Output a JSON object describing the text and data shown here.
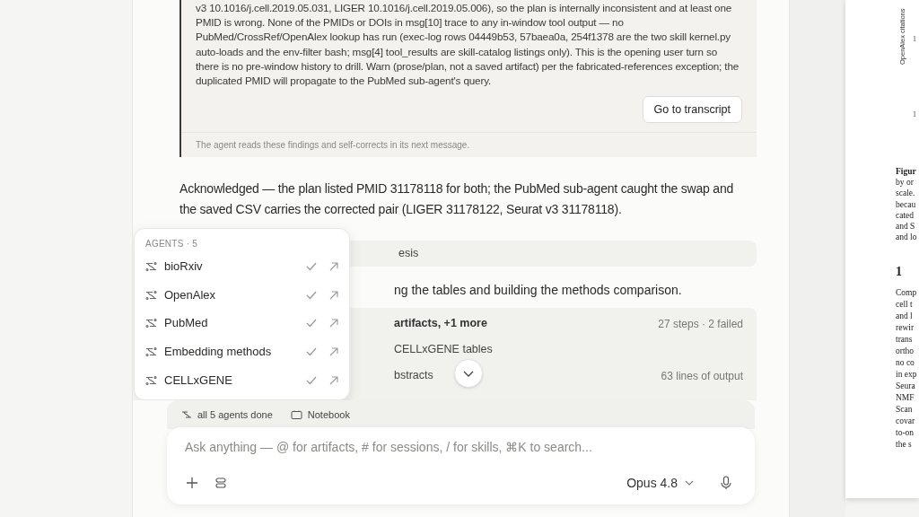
{
  "warning_card": {
    "body": "v3 10.1016/j.cell.2019.05.031, LIGER 10.1016/j.cell.2019.05.006), so the plan is internally inconsistent and at least one PMID is wrong. None of the PMIDs or DOIs in msg[10] trace to any in-window tool output — no PubMed/CrossRef/OpenAlex lookup has run (exec-log rows 04449b53, 57baea0a, 254f1378 are the two skill kernel.py auto-loads and the env-filter bash; msg[4] tool_results are skill-catalog listings only). This is the opening user turn so there is no pre-window history to drill. Warn (prose/plan, not a saved artifact) per the fabricated-references exception; the duplicated PMID will propagate to the PubMed sub-agent's query.",
    "button": "Go to transcript",
    "footer": "The agent reads these findings and self-corrects in its next message."
  },
  "message": "Acknowledged — the plan listed PMID 31178118 for both; the PubMed sub-agent caught the swap and the saved CSV carries the corrected pair (LIGER 31178122, Seurat v3 31178118).",
  "thinking_bar": "esis",
  "status_line": "ng the tables and building the methods comparison.",
  "activity_rows": [
    {
      "kind": "summary",
      "label": "artifacts, +1 more",
      "meta": "27 steps · 2 failed"
    },
    {
      "kind": "step",
      "label": "CELLxGENE tables"
    },
    {
      "kind": "step",
      "label": "bstracts",
      "meta": "63 lines of output"
    }
  ],
  "agents_popup": {
    "header": "AGENTS · 5",
    "items": [
      {
        "label": "bioRxiv",
        "done": true
      },
      {
        "label": "OpenAlex",
        "done": true
      },
      {
        "label": "PubMed",
        "done": true
      },
      {
        "label": "Embedding methods",
        "done": true
      },
      {
        "label": "CELLxGENE",
        "done": true
      }
    ]
  },
  "status_bar": {
    "agents": "all 5 agents done",
    "notebook": "Notebook"
  },
  "composer": {
    "placeholder": "Ask anything — @ for artifacts, # for sessions, / for skills, ⌘K to search...",
    "model": "Opus 4.8"
  },
  "document": {
    "axis_label": "OpenAlex citations",
    "ticks": [
      "1",
      "1"
    ],
    "caption_lines": [
      "Figur",
      "by or",
      "scale.",
      "becau",
      "cated",
      "and S",
      "and lo"
    ],
    "section": "1",
    "body_lines": [
      "Comp",
      "cell t",
      "and l",
      "rewir",
      "trans",
      "ortho",
      "no co",
      "in exp",
      "Seura",
      "NMF",
      "Scan",
      "covar",
      "to-on",
      "the s"
    ]
  }
}
